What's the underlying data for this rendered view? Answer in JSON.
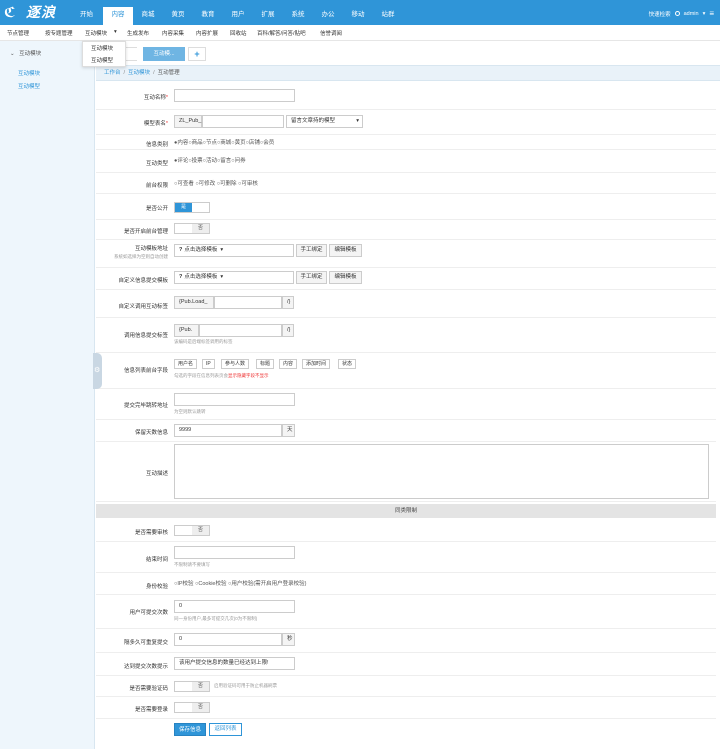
{
  "logo": {
    "text": "逐浪"
  },
  "nav": {
    "items": [
      {
        "label": "开始",
        "active": false
      },
      {
        "label": "内容",
        "active": true
      },
      {
        "label": "商城",
        "active": false
      },
      {
        "label": "黄页",
        "active": false
      },
      {
        "label": "教育",
        "active": false
      },
      {
        "label": "用户",
        "active": false
      },
      {
        "label": "扩展",
        "active": false
      },
      {
        "label": "系统",
        "active": false
      },
      {
        "label": "办公",
        "active": false
      },
      {
        "label": "移动",
        "active": false
      },
      {
        "label": "站群",
        "active": false
      }
    ],
    "quick_nav": "快速检索",
    "user": "admin",
    "caret": "▾",
    "menu": "≡"
  },
  "subbar": {
    "items": [
      "节点管理",
      "按专题管理",
      "互动模块",
      "▾",
      "生成发布",
      "内容采集",
      "内容扩展",
      "回收站",
      "百科/解答/问答/贴吧",
      "信誉调阅"
    ]
  },
  "dropdown": {
    "items": [
      "互动模块",
      "互动模型"
    ]
  },
  "sidebar": {
    "head": "互动模块",
    "head_icon": "⌄",
    "items": [
      "互动模块",
      "互动模型"
    ]
  },
  "tabs": {
    "active": "互动模...",
    "plus": "+"
  },
  "breadcrumb": {
    "items": [
      "工作台",
      "互动模块",
      "互动管理"
    ],
    "sep": "/"
  },
  "form": {
    "name_label": "互动名称",
    "req": "*",
    "table_label": "模型表名",
    "table_prefix": "ZL_Pub_",
    "table_select": "留言文章持的模型",
    "select_caret": "▾",
    "info_class_label": "信息类别",
    "info_class_opts": "●内容○商品○节点○商城○黄页○店铺○会员",
    "type_label": "互动类型",
    "type_opts": "●评论○投票○活动○留言○问券",
    "perm_label": "前台权限",
    "perm_opts": "○可查看 ○可修改 ○可删除 ○可审核",
    "public_label": "是否公开",
    "yes": "是",
    "no": "否",
    "admin_label": "是否开启前台管理",
    "template_label": "互动模板地址",
    "template_hint": "系统如选择为空则自动创建",
    "template_select": "点击选择模板",
    "help_icon": "?",
    "manual_bind": "手工绑定",
    "edit_template": "编辑模板",
    "custom_submit_label": "自定义信息提交模板",
    "custom_tag_label": "自定义调用互动标签",
    "custom_tag_prefix": "{Pub.Load_",
    "custom_tag_suffix": "/}",
    "call_tag_label": "调用信息提交标签",
    "call_tag_prefix": "{Pub.",
    "call_tag_suffix": "/}",
    "call_tag_hint": "该编码是后端标签调用的标签",
    "list_fields_label": "信息列表前台字段",
    "list_fields": [
      "用户名",
      "IP",
      "参与人数",
      "标题",
      "内容",
      "添加时间",
      "状态"
    ],
    "list_fields_hint": "勾选的字段在信息列表页会",
    "list_fields_hint_red": "显示隐藏字段不显示",
    "redirect_label": "提交完毕跳转地址",
    "redirect_hint": "为空则默认跳转",
    "keep_label": "保留天数信息",
    "keep_value": "9999",
    "keep_unit": "天",
    "desc_label": "互动描述",
    "section_title": "同类限制",
    "audit_label": "是否需要审核",
    "end_label": "结束时间",
    "end_hint": "不限制请不要填写",
    "identity_label": "身份校验",
    "identity_opts": "○IP校验 ○Cookie校验 ○用户校验(需开启用户登录校验)",
    "user_count_label": "用户可提交次数",
    "user_count_value": "0",
    "user_count_hint": "同一身份用户,最多可提交几次(0为不限制)",
    "interval_label": "隔多久可重复提交",
    "interval_value": "0",
    "interval_unit": "秒",
    "limit_tip_label": "达到提交次数提示",
    "limit_tip_value": "该用户提交信息的数量已经达到上限!",
    "captcha_label": "是否需要验证码",
    "captcha_hint": "启用验证码可用于防止机器刷票",
    "login_label": "是否需要登录",
    "save": "保存信息",
    "back": "返回列表"
  }
}
